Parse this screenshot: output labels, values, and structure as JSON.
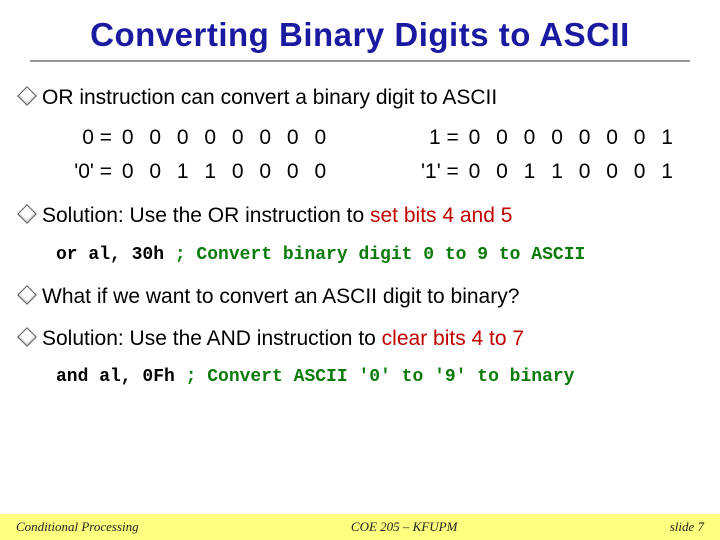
{
  "title": "Converting Binary Digits to ASCII",
  "bullets": {
    "b1_a": "OR instruction can convert a binary digit to ASCII",
    "b2_a": "Solution: Use the OR instruction to ",
    "b2_red": "set bits 4 and 5",
    "b3_a": "What if we want to convert an ASCII digit to binary?",
    "b4_a": "Solution: Use the AND instruction to ",
    "b4_red": "clear bits 4 to 7"
  },
  "bin": {
    "r1_left_lab": "0  =",
    "r1_left_bits": "0 0 0 0 0 0 0 0",
    "r1_right_lab": "1  =",
    "r1_right_bits": "0 0 0 0 0 0 0 1",
    "r2_left_lab": "'0' =",
    "r2_left_bits": "0 0 1 1 0 0 0 0",
    "r2_right_lab": "'1' =",
    "r2_right_bits": "0 0 1 1 0 0 0 1"
  },
  "code1": {
    "instr": "or   al, 30h   ",
    "cmt": "; Convert binary digit 0 to 9 to ASCII"
  },
  "code2": {
    "instr": "and  al, 0Fh   ",
    "cmt": "; Convert ASCII '0' to '9' to binary"
  },
  "footer": {
    "left": "Conditional Processing",
    "mid": "COE 205 – KFUPM",
    "right": "slide 7"
  }
}
